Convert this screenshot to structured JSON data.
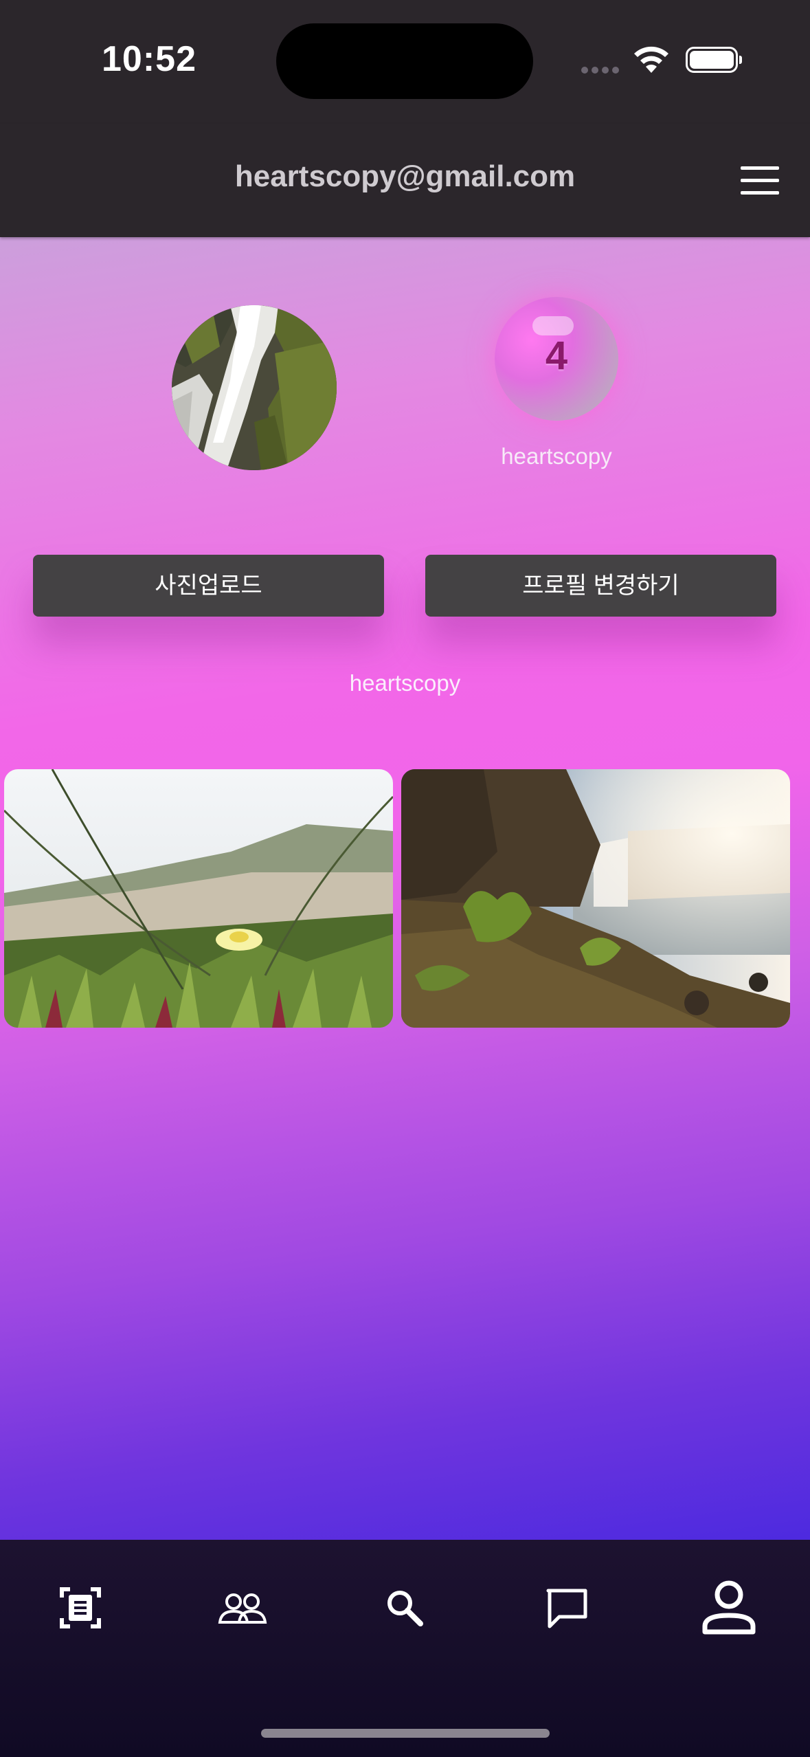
{
  "status_bar": {
    "time": "10:52"
  },
  "header": {
    "title": "heartscopy@gmail.com",
    "menu_icon": "hamburger-menu-icon"
  },
  "profile": {
    "badge_count": "4",
    "badge_name": "heartscopy",
    "username": "heartscopy",
    "avatar_image": "waterfall-rocks-photo"
  },
  "buttons": {
    "upload_label": "사진업로드",
    "edit_profile_label": "프로필 변경하기"
  },
  "photos": [
    {
      "name": "dune-grass-flower-photo"
    },
    {
      "name": "waterfall-cliff-photo"
    }
  ],
  "tabbar": {
    "items": [
      {
        "icon": "document-scan-icon"
      },
      {
        "icon": "people-icon"
      },
      {
        "icon": "search-icon"
      },
      {
        "icon": "chat-bubble-icon"
      },
      {
        "icon": "person-icon",
        "active": true
      }
    ]
  },
  "colors": {
    "header_bg": "#2b262b",
    "button_bg": "#444244",
    "gradient_top": "#cc9fdc",
    "gradient_mid": "#f267e8",
    "gradient_bottom": "#4d2adf",
    "tabbar_bg": "#120b27"
  }
}
